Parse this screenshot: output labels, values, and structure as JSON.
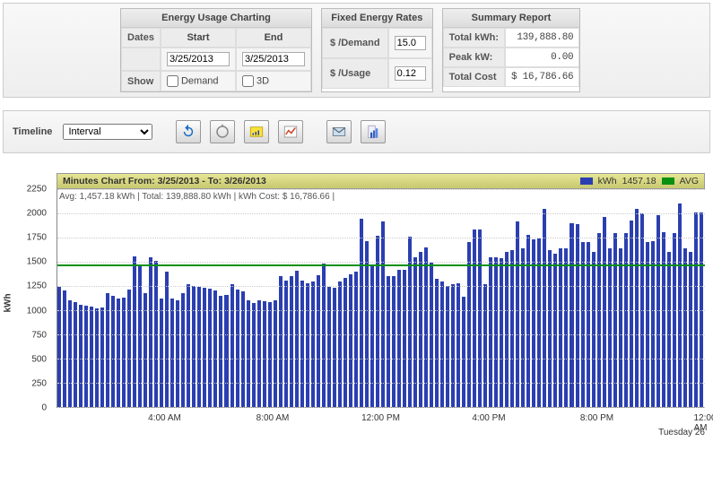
{
  "charting": {
    "title": "Energy Usage Charting",
    "dates_label": "Dates",
    "start_label": "Start",
    "end_label": "End",
    "start_value": "3/25/2013",
    "end_value": "3/25/2013",
    "show_label": "Show",
    "demand_label": "Demand",
    "threeD_label": "3D"
  },
  "rates": {
    "title": "Fixed Energy Rates",
    "demand_label": "$ /Demand",
    "demand_value": "15.0",
    "usage_label": "$ /Usage",
    "usage_value": "0.12"
  },
  "summary": {
    "title": "Summary Report",
    "total_kwh_label": "Total kWh:",
    "total_kwh_value": "139,888.80",
    "peak_kw_label": "Peak kW:",
    "peak_kw_value": "0.00",
    "total_cost_label": "Total Cost",
    "total_cost_value": "$ 16,786.66"
  },
  "timeline": {
    "label": "Timeline",
    "selected": "Interval"
  },
  "chart": {
    "title": "Minutes Chart From: 3/25/2013 - To: 3/26/2013",
    "legend_kwh": "kWh",
    "legend_avg_val": "1457.18",
    "legend_avg": "AVG",
    "info_line": "Avg: 1,457.18 kWh | Total: 139,888.80 kWh | kWh Cost: $  16,786.66 |",
    "y_title": "kWh",
    "x_day": "Tuesday 26"
  },
  "chart_data": {
    "type": "bar",
    "ylabel": "kWh",
    "ylim": [
      0,
      2250
    ],
    "avg": 1457.18,
    "x_ticks": [
      "4:00 AM",
      "8:00 AM",
      "12:00 PM",
      "4:00 PM",
      "8:00 PM",
      "12:00 AM"
    ],
    "y_ticks": [
      0,
      250,
      500,
      750,
      1000,
      1250,
      1500,
      1750,
      2000,
      2250
    ],
    "values": [
      1240,
      1200,
      1100,
      1080,
      1060,
      1050,
      1040,
      1020,
      1030,
      1180,
      1150,
      1120,
      1130,
      1210,
      1560,
      1460,
      1180,
      1550,
      1510,
      1120,
      1400,
      1120,
      1100,
      1180,
      1270,
      1250,
      1240,
      1230,
      1220,
      1200,
      1150,
      1160,
      1270,
      1210,
      1190,
      1100,
      1070,
      1100,
      1090,
      1080,
      1100,
      1350,
      1310,
      1350,
      1410,
      1310,
      1280,
      1300,
      1360,
      1480,
      1240,
      1230,
      1300,
      1330,
      1370,
      1400,
      1940,
      1710,
      1450,
      1770,
      1920,
      1350,
      1350,
      1420,
      1420,
      1760,
      1550,
      1600,
      1650,
      1490,
      1320,
      1300,
      1250,
      1270,
      1280,
      1140,
      1700,
      1830,
      1830,
      1270,
      1550,
      1550,
      1540,
      1600,
      1620,
      1920,
      1640,
      1780,
      1730,
      1740,
      2050,
      1620,
      1580,
      1640,
      1640,
      1900,
      1890,
      1700,
      1700,
      1600,
      1800,
      1960,
      1640,
      1800,
      1640,
      1800,
      1930,
      2050,
      2000,
      1700,
      1710,
      1980,
      1810,
      1600,
      1800,
      2100,
      1640,
      1600,
      2010,
      2010
    ]
  }
}
